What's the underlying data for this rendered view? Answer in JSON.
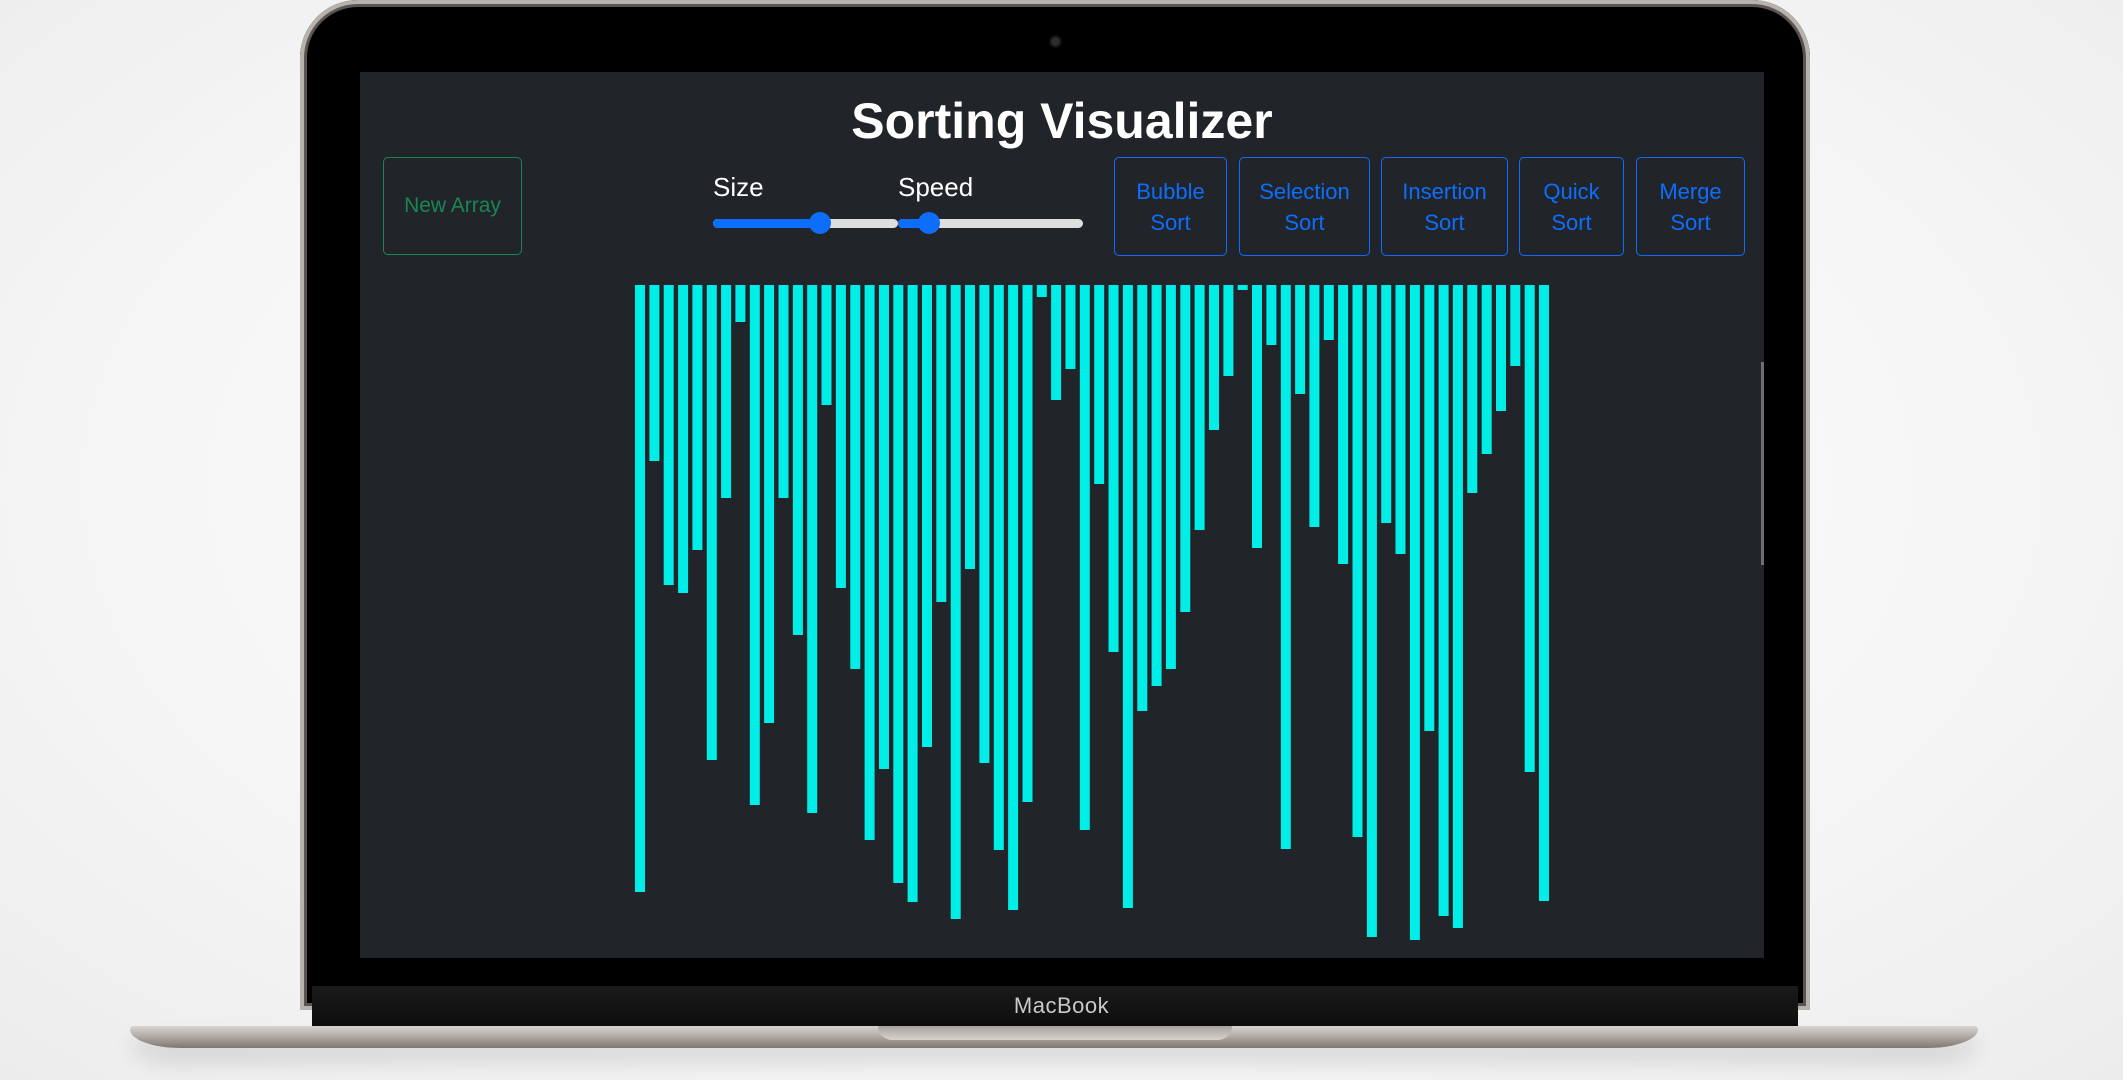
{
  "device": {
    "brand_label": "MacBook"
  },
  "app": {
    "title": "Sorting Visualizer",
    "new_array_label": "New Array",
    "size_label": "Size",
    "speed_label": "Speed",
    "size_value": 0.58,
    "speed_value": 0.17,
    "algorithms": [
      {
        "line1": "Bubble",
        "line2": "Sort"
      },
      {
        "line1": "Selection",
        "line2": "Sort"
      },
      {
        "line1": "Insertion",
        "line2": "Sort"
      },
      {
        "line1": "Quick",
        "line2": "Sort"
      },
      {
        "line1": "Merge",
        "line2": "Sort"
      }
    ]
  },
  "colors": {
    "bar": "#00eee8",
    "background": "#212429",
    "primary": "#0d6efd",
    "success": "#198754"
  },
  "array_values": [
    607,
    176,
    300,
    308,
    265,
    475,
    213,
    37,
    520,
    438,
    213,
    350,
    528,
    120,
    303,
    384,
    555,
    484,
    598,
    617,
    462,
    317,
    634,
    284,
    478,
    565,
    625,
    517,
    12,
    115,
    84,
    545,
    199,
    367,
    623,
    426,
    401,
    384,
    327,
    245,
    145,
    91,
    5,
    263,
    60,
    564,
    109,
    242,
    55,
    279,
    552,
    652,
    238,
    269,
    655,
    446,
    631,
    643,
    208,
    169,
    126,
    81,
    487,
    616
  ]
}
